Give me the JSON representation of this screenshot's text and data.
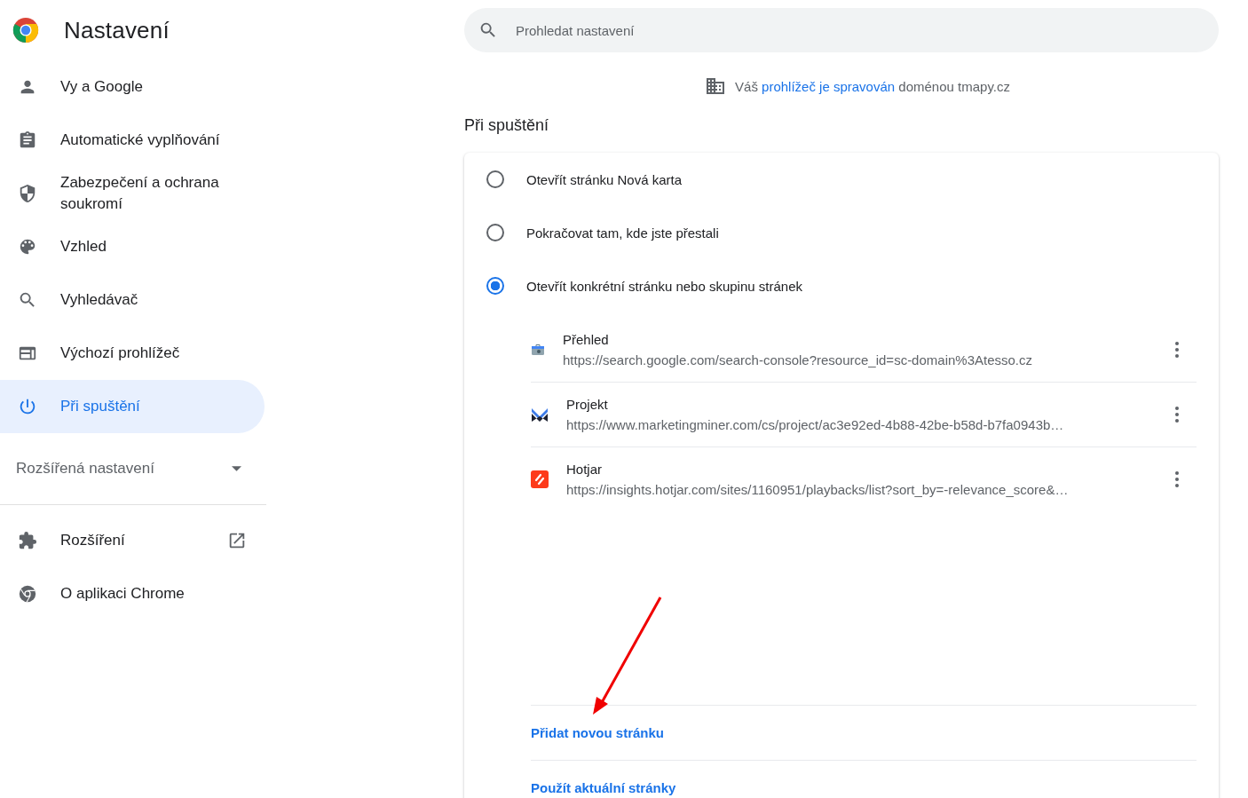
{
  "header": {
    "title": "Nastavení"
  },
  "search": {
    "placeholder": "Prohledat nastavení"
  },
  "sidebar": {
    "items": [
      {
        "label": "Vy a Google",
        "selected": false
      },
      {
        "label": "Automatické vyplňování",
        "selected": false
      },
      {
        "label": "Zabezpečení a ochrana soukromí",
        "selected": false
      },
      {
        "label": "Vzhled",
        "selected": false
      },
      {
        "label": "Vyhledávač",
        "selected": false
      },
      {
        "label": "Výchozí prohlížeč",
        "selected": false
      },
      {
        "label": "Při spuštění",
        "selected": true
      }
    ],
    "advanced": {
      "label": "Rozšířená nastavení",
      "expanded": false
    },
    "bottom_items": [
      {
        "label": "Rozšíření",
        "external": true
      },
      {
        "label": "O aplikaci Chrome",
        "external": false
      }
    ]
  },
  "notice": {
    "before": "Váš",
    "link": "prohlížeč je spravován",
    "after": "doménou tmapy.cz"
  },
  "section": {
    "title": "Při spuštění",
    "options": [
      {
        "label": "Otevřít stránku Nová karta",
        "selected": false
      },
      {
        "label": "Pokračovat tam, kde jste přestali",
        "selected": false
      },
      {
        "label": "Otevřít konkrétní stránku nebo skupinu stránek",
        "selected": true
      }
    ],
    "pages": [
      {
        "kind": "console",
        "title": "Přehled",
        "url": "https://search.google.com/search-console?resource_id=sc-domain%3Atesso.cz"
      },
      {
        "kind": "miner",
        "title": "Projekt",
        "url": "https://www.marketingminer.com/cs/project/ac3e92ed-4b88-42be-b58d-b7fa0943b…"
      },
      {
        "kind": "hotjar",
        "title": "Hotjar",
        "url": "https://insights.hotjar.com/sites/1160951/playbacks/list?sort_by=-relevance_score&…"
      }
    ],
    "actions": [
      "Přidat novou stránku",
      "Použít aktuální stránky"
    ]
  }
}
